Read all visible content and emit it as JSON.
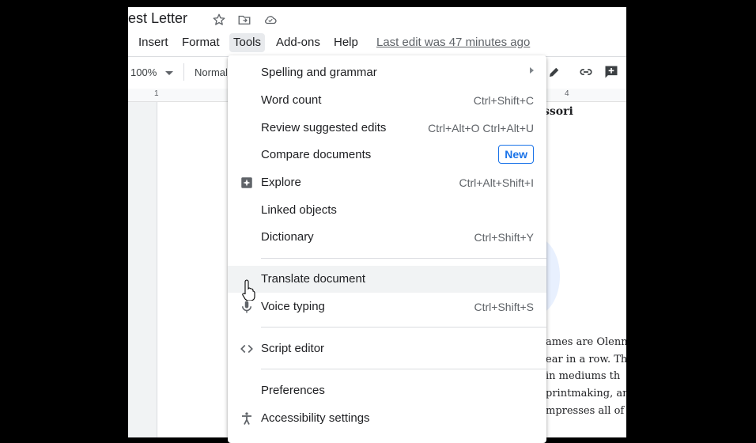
{
  "document": {
    "title": "est Letter",
    "last_edit": "Last edit was 47 minutes ago"
  },
  "menubar": {
    "items": [
      "Insert",
      "Format",
      "Tools",
      "Add-ons",
      "Help"
    ],
    "active": "Tools"
  },
  "toolbar": {
    "zoom": "100%",
    "style": "Normal"
  },
  "ruler": {
    "labels": [
      "1",
      "4"
    ]
  },
  "page_text": {
    "heading": "ssori",
    "lines": [
      "ames are Olenn",
      "ear in a row. Th",
      "in mediums th",
      "printmaking, an",
      "mpresses all of"
    ]
  },
  "tools_menu": {
    "items": [
      {
        "label": "Spelling and grammar",
        "shortcut": "",
        "icon": "",
        "submenu": true
      },
      {
        "label": "Word count",
        "shortcut": "Ctrl+Shift+C",
        "icon": ""
      },
      {
        "label": "Review suggested edits",
        "shortcut": "Ctrl+Alt+O Ctrl+Alt+U",
        "icon": ""
      },
      {
        "label": "Compare documents",
        "shortcut": "",
        "icon": "",
        "badge": "New"
      },
      {
        "label": "Explore",
        "shortcut": "Ctrl+Alt+Shift+I",
        "icon": "explore-icon"
      },
      {
        "label": "Linked objects",
        "shortcut": "",
        "icon": ""
      },
      {
        "label": "Dictionary",
        "shortcut": "Ctrl+Shift+Y",
        "icon": ""
      },
      {
        "label": "Translate document",
        "shortcut": "",
        "icon": "",
        "hovered": true
      },
      {
        "label": "Voice typing",
        "shortcut": "Ctrl+Shift+S",
        "icon": "microphone-icon"
      },
      {
        "label": "Script editor",
        "shortcut": "",
        "icon": "code-icon"
      },
      {
        "label": "Preferences",
        "shortcut": "",
        "icon": ""
      },
      {
        "label": "Accessibility settings",
        "shortcut": "",
        "icon": "accessibility-icon"
      }
    ]
  },
  "colors": {
    "accent": "#1a73e8",
    "hover": "#f1f3f4",
    "text": "#202124",
    "muted": "#5f6368"
  }
}
